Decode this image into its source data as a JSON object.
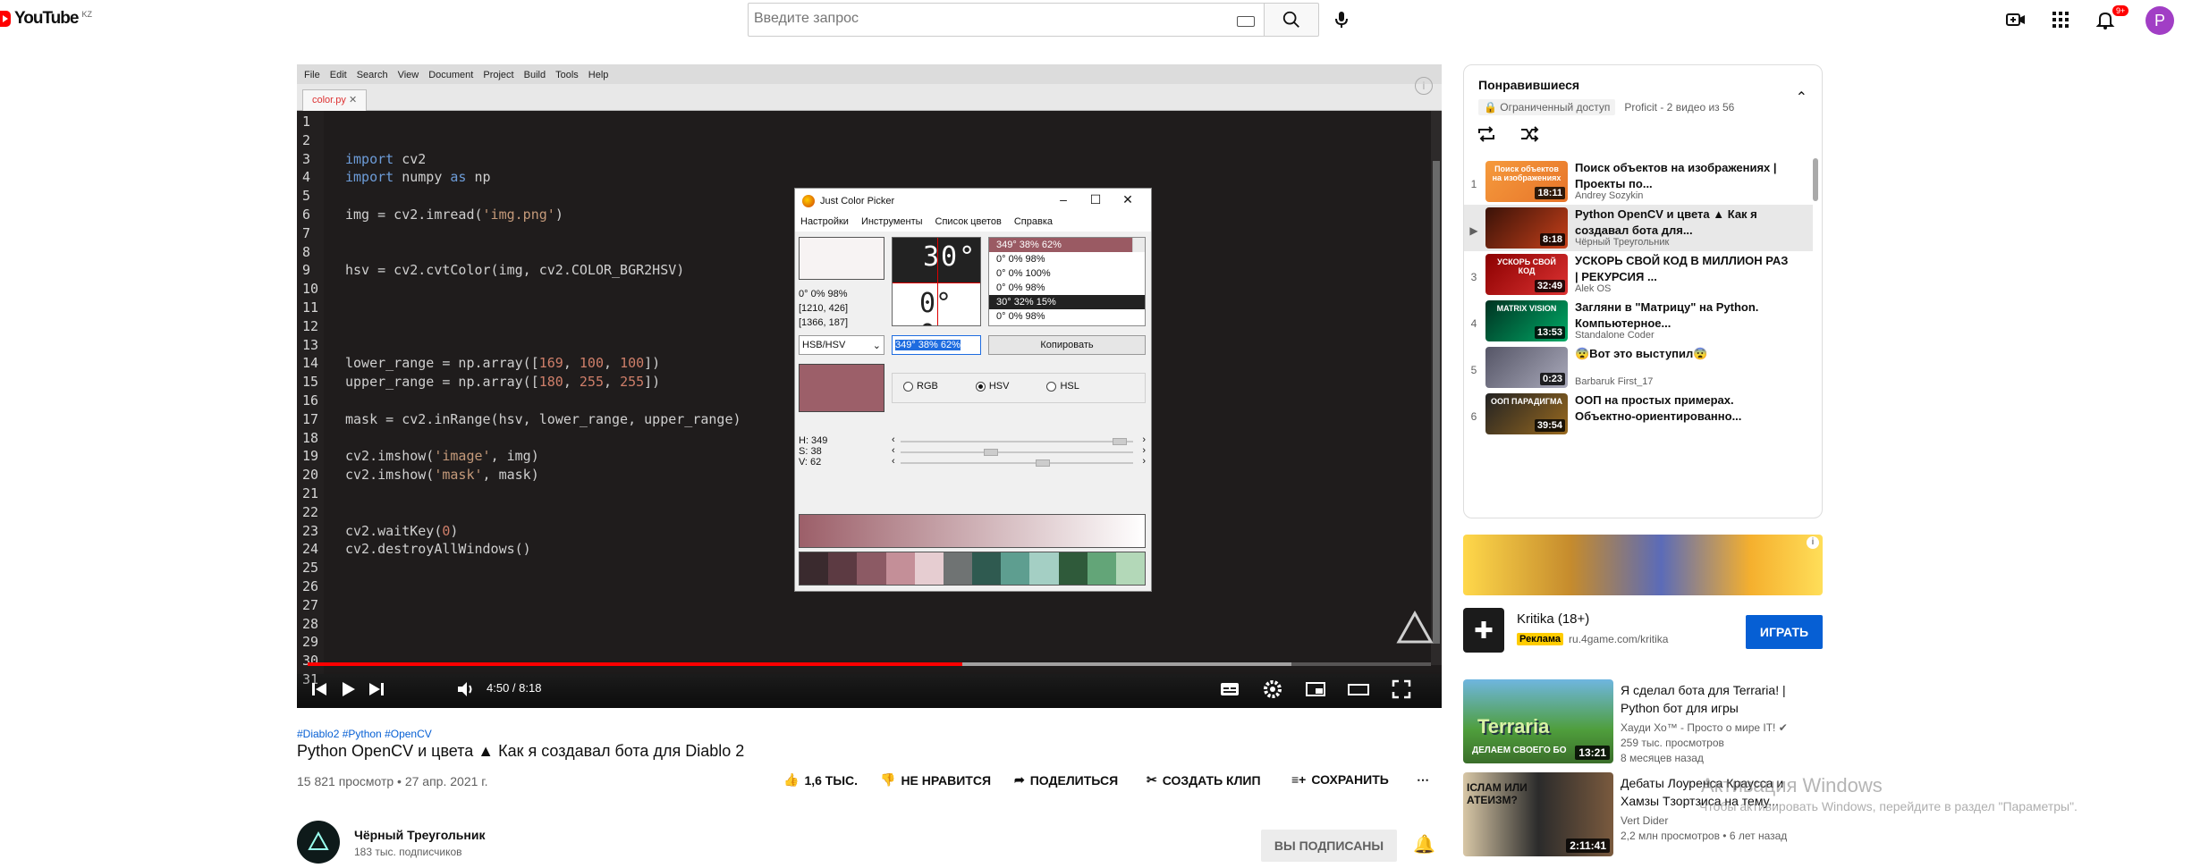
{
  "header": {
    "logo_text": "YouTube",
    "country": "KZ",
    "search_placeholder": "Введите запрос",
    "notif_count": "9+",
    "avatar_letter": "P"
  },
  "ide": {
    "menu": [
      "File",
      "Edit",
      "Search",
      "View",
      "Document",
      "Project",
      "Build",
      "Tools",
      "Help"
    ],
    "tab": "color.py",
    "line_numbers": [
      "1",
      "2",
      "3",
      "4",
      "5",
      "6",
      "7",
      "8",
      "9",
      "10",
      "11",
      "12",
      "13",
      "14",
      "15",
      "16",
      "17",
      "18",
      "19",
      "20",
      "21",
      "22",
      "23",
      "24",
      "25",
      "26",
      "27",
      "28",
      "29",
      "30",
      "31"
    ]
  },
  "player": {
    "time": "4:50 / 8:18",
    "progress": 0.583
  },
  "picker": {
    "title": "Just Color Picker",
    "menu": [
      "Настройки",
      "Инструменты",
      "Список цветов",
      "Справка"
    ],
    "info_lines": [
      "0° 0% 98%",
      "[1210, 426]",
      "[1366, 187]"
    ],
    "zoom_top": "30°",
    "zoom_bottom": "0° 0",
    "list": [
      "349° 38% 62%",
      "0° 0% 98%",
      "0° 0% 100%",
      "0° 0% 98%",
      "30° 32% 15%",
      "0° 0% 98%"
    ],
    "mode": "HSB/HSV",
    "value": "349° 38% 62%",
    "copy": "Копировать",
    "radios": [
      "RGB",
      "HSV",
      "HSL"
    ],
    "h_label": "H: 349",
    "s_label": "S: 38",
    "v_label": "V: 62",
    "h": 349,
    "s": 38,
    "v": 62,
    "colors": {
      "current": "#9c5f69"
    },
    "palette": [
      "#3a2a2e",
      "#5c3a42",
      "#8c5a64",
      "#c48f98",
      "#e6cdd1",
      "#6f7373",
      "#2f5a50",
      "#5e9e90",
      "#a4cfc4",
      "#2f5a3a",
      "#63a578",
      "#b3d8b8"
    ]
  },
  "playlist": {
    "title": "Понравившиеся",
    "access": "Ограниченный доступ",
    "meta": "Proficit - 2 видео из 56",
    "items": [
      {
        "idx": "1",
        "title": "Поиск объектов на изображениях | Проекты по...",
        "channel": "Andrey Sozykin",
        "dur": "18:11",
        "thumb_text": "Поиск объектов на изображениях"
      },
      {
        "idx": "▶",
        "title": "Python OpenCV и цвета ▲ Как я создавал бота для...",
        "channel": "Чёрный Треугольник",
        "dur": "8:18",
        "thumb_text": ""
      },
      {
        "idx": "3",
        "title": "УСКОРЬ СВОЙ КОД В МИЛЛИОН РАЗ | РЕКУРСИЯ ...",
        "channel": "Alek OS",
        "dur": "32:49",
        "thumb_text": "УСКОРЬ СВОЙ КОД"
      },
      {
        "idx": "4",
        "title": "Загляни в \"Матрицу\" на Python. Компьютерное...",
        "channel": "Standalone Coder",
        "dur": "13:53",
        "thumb_text": "MATRIX VISION"
      },
      {
        "idx": "5",
        "title": "😨Вот это выступил😨",
        "channel": "Barbaruk First_17",
        "dur": "0:23",
        "thumb_text": ""
      },
      {
        "idx": "6",
        "title": "ООП на простых примерах. Объектно-ориентированно...",
        "channel": "",
        "dur": "39:54",
        "thumb_text": "ООП ПАРАДИГМА"
      }
    ]
  },
  "ad": {
    "title": "Kritika (18+)",
    "tag": "Реклама",
    "url": "ru.4game.com/kritika",
    "play": "ИГРАТЬ"
  },
  "recs": [
    {
      "title": "Я сделал бота для Terraria! | Python бот для игры",
      "channel": "Хауди Хо™ - Просто о мире IT!",
      "meta1": "259 тыс. просмотров",
      "meta2": "8 месяцев назад",
      "dur": "13:21",
      "thumb_text": "Terraria",
      "thumb_sub": "ДЕЛАЕМ СВОЕГО БО"
    },
    {
      "title": "Дебаты Лоуренса Краусса и Хамзы Тзортзиса на тему...",
      "channel": "Vert Dider",
      "meta1": "2,2 млн просмотров • 6 лет назад",
      "meta2": "",
      "dur": "2:11:41",
      "thumb_text": "ІСЛАМ ИЛИ АТЕИЗМ?",
      "thumb_sub": ""
    }
  ],
  "video": {
    "tags": "#Diablo2 #Python #OpenCV",
    "title": "Python OpenCV и цвета ▲ Как я создавал бота для Diablo 2",
    "stats": "15 821 просмотр • 27 апр. 2021 г.",
    "likes": "1,6 ТЫС.",
    "dislike": "НЕ НРАВИТСЯ",
    "share": "ПОДЕЛИТЬСЯ",
    "clip": "СОЗДАТЬ КЛИП",
    "save": "СОХРАНИТЬ",
    "more": "⋯",
    "channel": "Чёрный Треугольник",
    "subs": "183 тыс. подписчиков",
    "subscribed": "ВЫ ПОДПИСАНЫ"
  },
  "watermark": {
    "line1": "Активация Windows",
    "line2": "Чтобы активировать Windows, перейдите в раздел \"Параметры\"."
  }
}
